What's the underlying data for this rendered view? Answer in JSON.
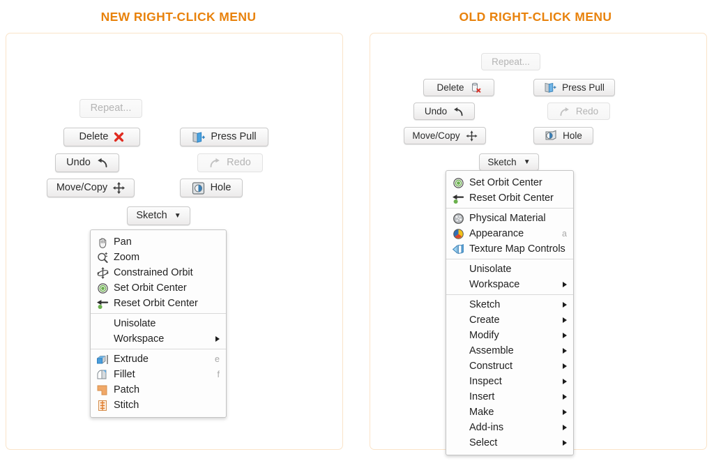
{
  "theme": {
    "accent": "#e8820c",
    "panel_border": "#fae3c8",
    "menu_bg": "#fdfdfd"
  },
  "left": {
    "title": "NEW RIGHT-CLICK MENU",
    "buttons": {
      "repeat": "Repeat...",
      "delete": "Delete",
      "press_pull": "Press Pull",
      "undo": "Undo",
      "redo": "Redo",
      "move_copy": "Move/Copy",
      "hole": "Hole",
      "sketch": "Sketch"
    },
    "menu": [
      [
        {
          "icon": "pan-icon",
          "label": "Pan"
        },
        {
          "icon": "zoom-icon",
          "label": "Zoom"
        },
        {
          "icon": "constrained-orbit-icon",
          "label": "Constrained Orbit"
        },
        {
          "icon": "set-orbit-center-icon",
          "label": "Set Orbit Center"
        },
        {
          "icon": "reset-orbit-center-icon",
          "label": "Reset Orbit Center"
        }
      ],
      [
        {
          "icon": null,
          "label": "Unisolate"
        },
        {
          "icon": null,
          "label": "Workspace",
          "arrow": true
        }
      ],
      [
        {
          "icon": "extrude-icon",
          "label": "Extrude",
          "shortcut": "e"
        },
        {
          "icon": "fillet-icon",
          "label": "Fillet",
          "shortcut": "f"
        },
        {
          "icon": "patch-icon",
          "label": "Patch"
        },
        {
          "icon": "stitch-icon",
          "label": "Stitch"
        }
      ]
    ]
  },
  "right": {
    "title": "OLD RIGHT-CLICK MENU",
    "buttons": {
      "repeat": "Repeat...",
      "delete": "Delete",
      "press_pull": "Press Pull",
      "undo": "Undo",
      "redo": "Redo",
      "move_copy": "Move/Copy",
      "hole": "Hole",
      "sketch": "Sketch"
    },
    "menu": [
      [
        {
          "icon": "set-orbit-center-icon",
          "label": "Set Orbit Center"
        },
        {
          "icon": "reset-orbit-center-icon",
          "label": "Reset Orbit Center"
        }
      ],
      [
        {
          "icon": "physical-material-icon",
          "label": "Physical Material"
        },
        {
          "icon": "appearance-icon",
          "label": "Appearance",
          "shortcut": "a"
        },
        {
          "icon": "texture-map-controls-icon",
          "label": "Texture Map Controls"
        }
      ],
      [
        {
          "icon": null,
          "label": "Unisolate"
        },
        {
          "icon": null,
          "label": "Workspace",
          "arrow": true
        }
      ],
      [
        {
          "icon": null,
          "label": "Sketch",
          "arrow": true
        },
        {
          "icon": null,
          "label": "Create",
          "arrow": true
        },
        {
          "icon": null,
          "label": "Modify",
          "arrow": true
        },
        {
          "icon": null,
          "label": "Assemble",
          "arrow": true
        },
        {
          "icon": null,
          "label": "Construct",
          "arrow": true
        },
        {
          "icon": null,
          "label": "Inspect",
          "arrow": true
        },
        {
          "icon": null,
          "label": "Insert",
          "arrow": true
        },
        {
          "icon": null,
          "label": "Make",
          "arrow": true
        },
        {
          "icon": null,
          "label": "Add-ins",
          "arrow": true
        },
        {
          "icon": null,
          "label": "Select",
          "arrow": true
        }
      ]
    ]
  }
}
